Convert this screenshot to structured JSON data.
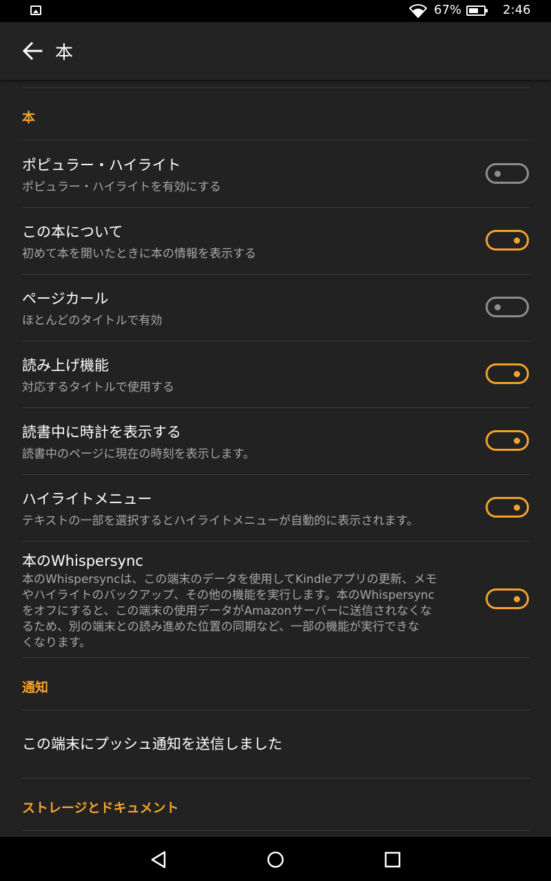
{
  "status": {
    "battery": "67%",
    "battery_level": 0.67,
    "time": "2:46"
  },
  "appbar": {
    "title": "本"
  },
  "sections": {
    "books": "本",
    "notifications": "通知",
    "storage": "ストレージとドキュメント"
  },
  "settings": [
    {
      "title": "ポピュラー・ハイライト",
      "subtitle": "ポピュラー・ハイライトを有効にする",
      "enabled": false
    },
    {
      "title": "この本について",
      "subtitle": "初めて本を開いたときに本の情報を表示する",
      "enabled": true
    },
    {
      "title": "ページカール",
      "subtitle": "ほとんどのタイトルで有効",
      "enabled": false
    },
    {
      "title": "読み上げ機能",
      "subtitle": "対応するタイトルで使用する",
      "enabled": true
    },
    {
      "title": "読書中に時計を表示する",
      "subtitle": "読書中のページに現在の時刻を表示します。",
      "enabled": true
    },
    {
      "title": "ハイライトメニュー",
      "subtitle": "テキストの一部を選択するとハイライトメニューが自動的に表示されます。",
      "enabled": true
    }
  ],
  "whispersync": {
    "title": "本のWhispersync",
    "lines": [
      "本のWhispersyncは、この端末のデータを使用してKindleアプリの更新、メモ",
      "やハイライトのバックアップ、その他の機能を実行します。本のWhispersync",
      "をオフにすると、この端末の使用データがAmazonサーバーに送信されなくな",
      "るため、別の端末との読み進めた位置の同期など、一部の機能が実行できな",
      "くなります。"
    ],
    "enabled": true
  },
  "notification_item": "この端末にプッシュ通知を送信しました",
  "colors": {
    "accent": "#f6a22b",
    "background": "#222222",
    "toggle_off": "#8e8e8e"
  },
  "icons": [
    "image-icon",
    "wifi-icon",
    "battery-icon",
    "back-arrow-icon",
    "nav-back-icon",
    "nav-home-icon",
    "nav-recents-icon"
  ]
}
